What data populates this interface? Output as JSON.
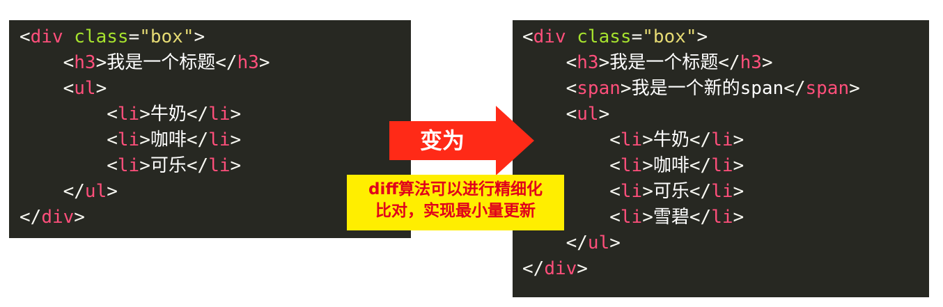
{
  "left_code": [
    [
      {
        "t": "<",
        "c": "punc"
      },
      {
        "t": "div",
        "c": "tag"
      },
      {
        "t": " ",
        "c": "punc"
      },
      {
        "t": "class",
        "c": "attr"
      },
      {
        "t": "=",
        "c": "punc"
      },
      {
        "t": "\"box\"",
        "c": "str"
      },
      {
        "t": ">",
        "c": "punc"
      }
    ],
    [
      {
        "t": "    <",
        "c": "punc"
      },
      {
        "t": "h3",
        "c": "tag"
      },
      {
        "t": ">",
        "c": "punc"
      },
      {
        "t": "我是一个标题",
        "c": "text"
      },
      {
        "t": "</",
        "c": "punc"
      },
      {
        "t": "h3",
        "c": "tag"
      },
      {
        "t": ">",
        "c": "punc"
      }
    ],
    [
      {
        "t": "    <",
        "c": "punc"
      },
      {
        "t": "ul",
        "c": "tag"
      },
      {
        "t": ">",
        "c": "punc"
      }
    ],
    [
      {
        "t": "        <",
        "c": "punc"
      },
      {
        "t": "li",
        "c": "tag"
      },
      {
        "t": ">",
        "c": "punc"
      },
      {
        "t": "牛奶",
        "c": "text"
      },
      {
        "t": "</",
        "c": "punc"
      },
      {
        "t": "li",
        "c": "tag"
      },
      {
        "t": ">",
        "c": "punc"
      }
    ],
    [
      {
        "t": "        <",
        "c": "punc"
      },
      {
        "t": "li",
        "c": "tag"
      },
      {
        "t": ">",
        "c": "punc"
      },
      {
        "t": "咖啡",
        "c": "text"
      },
      {
        "t": "</",
        "c": "punc"
      },
      {
        "t": "li",
        "c": "tag"
      },
      {
        "t": ">",
        "c": "punc"
      }
    ],
    [
      {
        "t": "        <",
        "c": "punc"
      },
      {
        "t": "li",
        "c": "tag"
      },
      {
        "t": ">",
        "c": "punc"
      },
      {
        "t": "可乐",
        "c": "text"
      },
      {
        "t": "</",
        "c": "punc"
      },
      {
        "t": "li",
        "c": "tag"
      },
      {
        "t": ">",
        "c": "punc"
      }
    ],
    [
      {
        "t": "    </",
        "c": "punc"
      },
      {
        "t": "ul",
        "c": "tag"
      },
      {
        "t": ">",
        "c": "punc"
      }
    ],
    [
      {
        "t": "</",
        "c": "punc"
      },
      {
        "t": "div",
        "c": "tag"
      },
      {
        "t": ">",
        "c": "punc"
      }
    ]
  ],
  "right_code": [
    [
      {
        "t": "<",
        "c": "punc"
      },
      {
        "t": "div",
        "c": "tag"
      },
      {
        "t": " ",
        "c": "punc"
      },
      {
        "t": "class",
        "c": "attr"
      },
      {
        "t": "=",
        "c": "punc"
      },
      {
        "t": "\"box\"",
        "c": "str"
      },
      {
        "t": ">",
        "c": "punc"
      }
    ],
    [
      {
        "t": "    <",
        "c": "punc"
      },
      {
        "t": "h3",
        "c": "tag"
      },
      {
        "t": ">",
        "c": "punc"
      },
      {
        "t": "我是一个标题",
        "c": "text"
      },
      {
        "t": "</",
        "c": "punc"
      },
      {
        "t": "h3",
        "c": "tag"
      },
      {
        "t": ">",
        "c": "punc"
      }
    ],
    [
      {
        "t": "    <",
        "c": "punc"
      },
      {
        "t": "span",
        "c": "tag"
      },
      {
        "t": ">",
        "c": "punc"
      },
      {
        "t": "我是一个新的span",
        "c": "text"
      },
      {
        "t": "</",
        "c": "punc"
      },
      {
        "t": "span",
        "c": "tag"
      },
      {
        "t": ">",
        "c": "punc"
      }
    ],
    [
      {
        "t": "    <",
        "c": "punc"
      },
      {
        "t": "ul",
        "c": "tag"
      },
      {
        "t": ">",
        "c": "punc"
      }
    ],
    [
      {
        "t": "        <",
        "c": "punc"
      },
      {
        "t": "li",
        "c": "tag"
      },
      {
        "t": ">",
        "c": "punc"
      },
      {
        "t": "牛奶",
        "c": "text"
      },
      {
        "t": "</",
        "c": "punc"
      },
      {
        "t": "li",
        "c": "tag"
      },
      {
        "t": ">",
        "c": "punc"
      }
    ],
    [
      {
        "t": "        <",
        "c": "punc"
      },
      {
        "t": "li",
        "c": "tag"
      },
      {
        "t": ">",
        "c": "punc"
      },
      {
        "t": "咖啡",
        "c": "text"
      },
      {
        "t": "</",
        "c": "punc"
      },
      {
        "t": "li",
        "c": "tag"
      },
      {
        "t": ">",
        "c": "punc"
      }
    ],
    [
      {
        "t": "        <",
        "c": "punc"
      },
      {
        "t": "li",
        "c": "tag"
      },
      {
        "t": ">",
        "c": "punc"
      },
      {
        "t": "可乐",
        "c": "text"
      },
      {
        "t": "</",
        "c": "punc"
      },
      {
        "t": "li",
        "c": "tag"
      },
      {
        "t": ">",
        "c": "punc"
      }
    ],
    [
      {
        "t": "        <",
        "c": "punc"
      },
      {
        "t": "li",
        "c": "tag"
      },
      {
        "t": ">",
        "c": "punc"
      },
      {
        "t": "雪碧",
        "c": "text"
      },
      {
        "t": "</",
        "c": "punc"
      },
      {
        "t": "li",
        "c": "tag"
      },
      {
        "t": ">",
        "c": "punc"
      }
    ],
    [
      {
        "t": "    </",
        "c": "punc"
      },
      {
        "t": "ul",
        "c": "tag"
      },
      {
        "t": ">",
        "c": "punc"
      }
    ],
    [
      {
        "t": "</",
        "c": "punc"
      },
      {
        "t": "div",
        "c": "tag"
      },
      {
        "t": ">",
        "c": "punc"
      }
    ]
  ],
  "arrow": {
    "label": "变为",
    "color": "#ff2a17"
  },
  "note": {
    "line1": "diff算法可以进行精细化",
    "line2": "比对，实现最小量更新",
    "bg_color": "#ffee00",
    "text_color": "#e0001b"
  },
  "colors": {
    "panel_bg": "#272822",
    "tag": "#ff4f7b",
    "attr": "#a6e22e",
    "string": "#e6db74",
    "text": "#ffffff"
  }
}
